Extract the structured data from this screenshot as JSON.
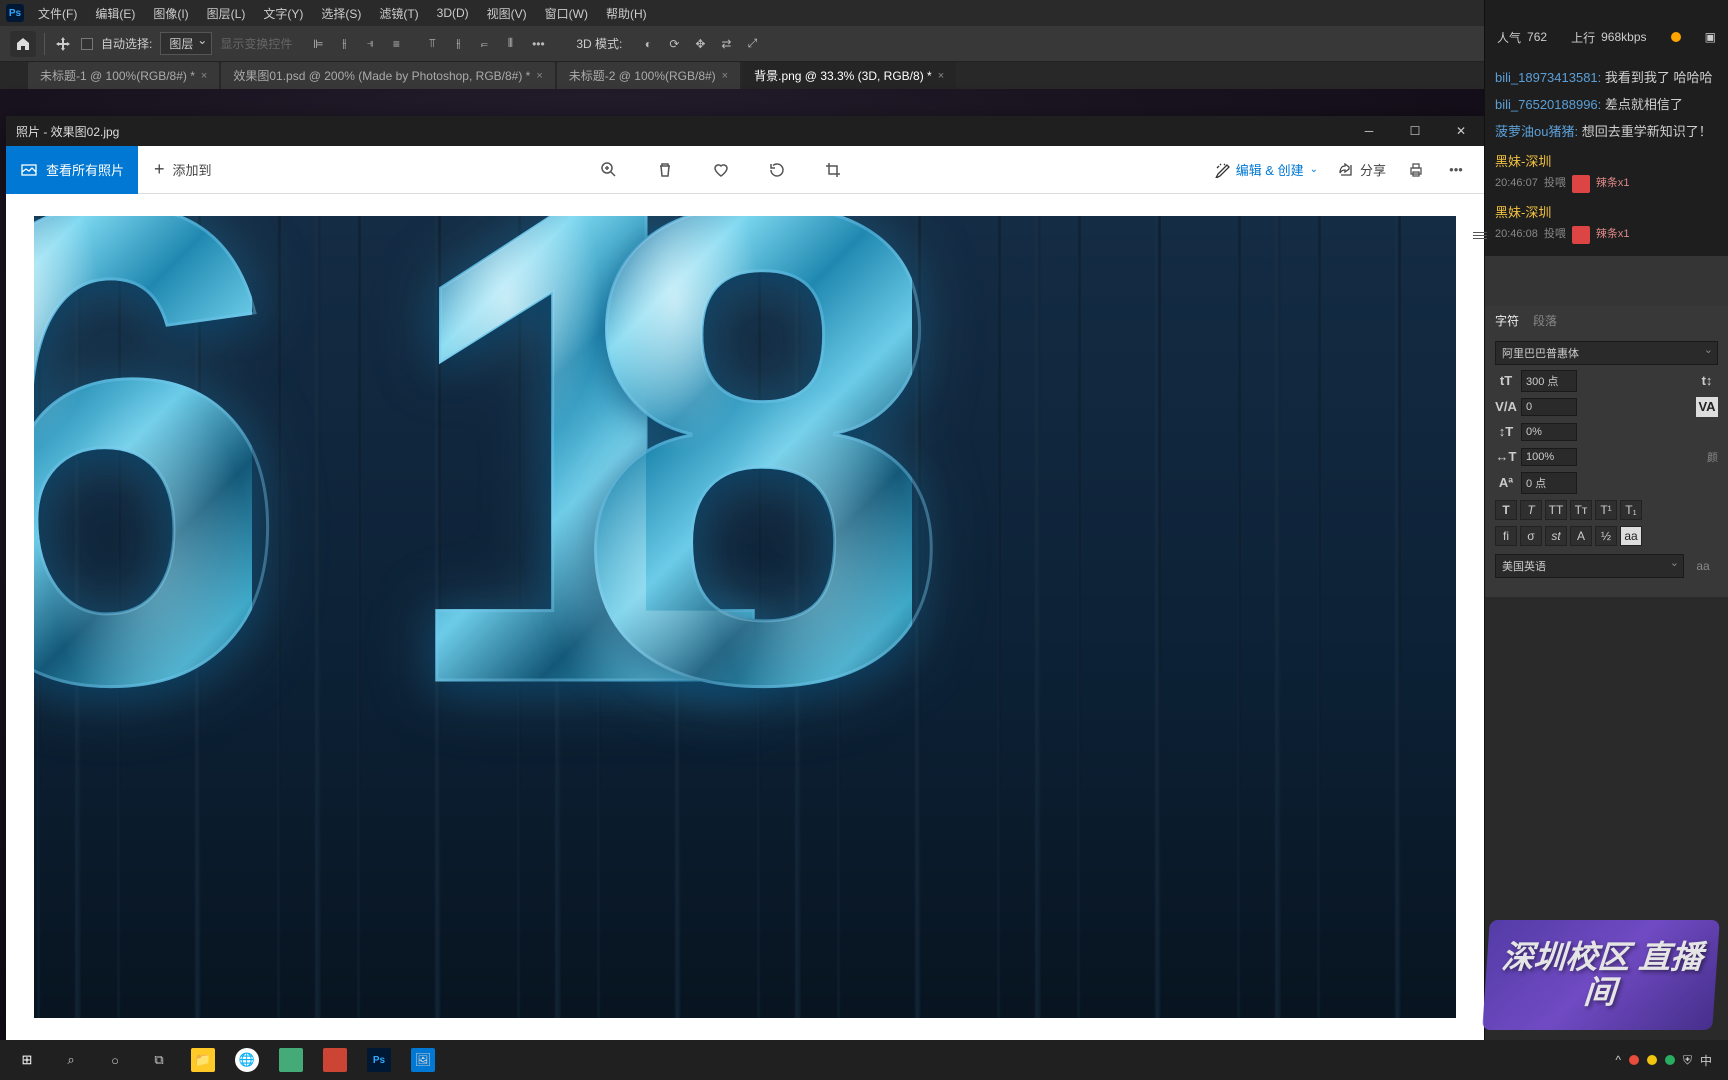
{
  "menubar": {
    "items": [
      "文件(F)",
      "编辑(E)",
      "图像(I)",
      "图层(L)",
      "文字(Y)",
      "选择(S)",
      "滤镜(T)",
      "3D(D)",
      "视图(V)",
      "窗口(W)",
      "帮助(H)"
    ]
  },
  "optionsbar": {
    "auto_select": "自动选择:",
    "layer_dropdown": "图层",
    "transform_controls": "显示变换控件",
    "three_d_mode": "3D 模式:"
  },
  "tabs": [
    {
      "label": "未标题-1 @ 100%(RGB/8#) *",
      "active": false
    },
    {
      "label": "效果图01.psd @ 200% (Made by Photoshop, RGB/8#) *",
      "active": false
    },
    {
      "label": "未标题-2 @ 100%(RGB/8#)",
      "active": false
    },
    {
      "label": "背景.png @ 33.3% (3D, RGB/8) *",
      "active": true
    }
  ],
  "photos": {
    "title": "照片 - 效果图02.jpg",
    "view_all": "查看所有照片",
    "add_to": "添加到",
    "edit_create": "编辑 & 创建",
    "share": "分享"
  },
  "stream": {
    "popularity_label": "人气",
    "popularity_value": "762",
    "upload_label": "上行",
    "upload_value": "968kbps"
  },
  "chat": [
    {
      "user": "bili_18973413581:",
      "text": "我看到我了 哈哈哈"
    },
    {
      "user": "bili_76520188996:",
      "text": "差点就相信了"
    },
    {
      "user": "菠萝油ou猪猪:",
      "text": "想回去重学新知识了！"
    }
  ],
  "gifts": [
    {
      "name": "黑妹-深圳",
      "time": "20:46:07",
      "action": "投喂",
      "item": "辣条x1"
    },
    {
      "name": "黑妹-深圳",
      "time": "20:46:08",
      "action": "投喂",
      "item": "辣条x1"
    }
  ],
  "char_panel": {
    "tab_char": "字符",
    "tab_para": "段落",
    "font": "阿里巴巴普惠体",
    "size": "300 点",
    "va": "0",
    "tracking": "0%",
    "vscale": "100%",
    "baseline": "0 点",
    "lang": "美国英语",
    "aa": "aa"
  },
  "overlay_text": "深圳校区\n直播间",
  "image_content": "618"
}
